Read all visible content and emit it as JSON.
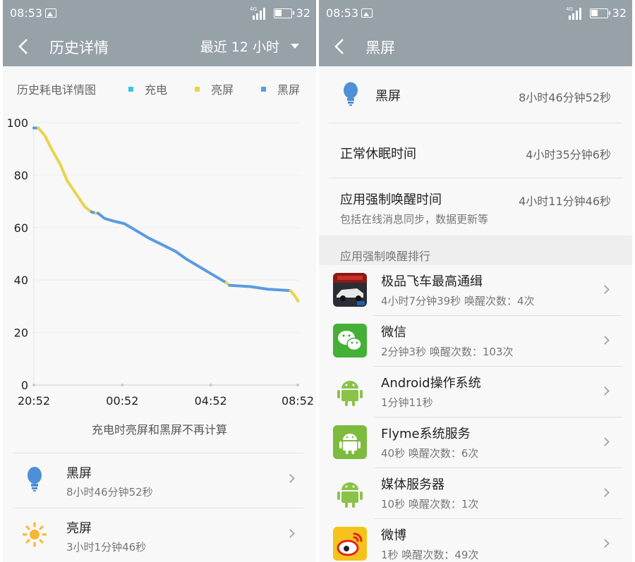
{
  "left": {
    "status_bar": {
      "time": "08:53",
      "network": "4G",
      "battery_level": "32"
    },
    "header": {
      "back_icon": "chevron-left-icon",
      "title": "历史详情",
      "filter": "最近 12 小时"
    },
    "chart_section": {
      "title": "历史耗电详情图",
      "legend": [
        {
          "label": "充电",
          "color": "#3cc3df"
        },
        {
          "label": "亮屏",
          "color": "#e8d44d"
        },
        {
          "label": "黑屏",
          "color": "#5b9be0"
        }
      ],
      "note": "充电时亮屏和黑屏不再计算"
    },
    "chart_data": {
      "type": "line",
      "ylim": [
        0,
        100
      ],
      "y_ticks": [
        "100",
        "80",
        "60",
        "40",
        "20",
        "0"
      ],
      "x_ticks": [
        "20:52",
        "00:52",
        "04:52",
        "08:52"
      ],
      "x_range_hours": [
        0,
        12
      ],
      "series": [
        {
          "name": "黑屏",
          "color": "#5b9be0",
          "points": [
            [
              0,
              98
            ],
            [
              0.2,
              98
            ]
          ]
        },
        {
          "name": "亮屏",
          "color": "#e8d44d",
          "points": [
            [
              0.2,
              98
            ],
            [
              0.5,
              95
            ],
            [
              0.8,
              90
            ],
            [
              1.2,
              84
            ],
            [
              1.5,
              78
            ],
            [
              1.9,
              73
            ],
            [
              2.3,
              68
            ],
            [
              2.6,
              66
            ]
          ]
        },
        {
          "name": "黑屏",
          "color": "#5b9be0",
          "points": [
            [
              2.6,
              66
            ],
            [
              2.8,
              65.5
            ]
          ]
        },
        {
          "name": "亮屏",
          "color": "#e8d44d",
          "points": [
            [
              2.8,
              65.5
            ],
            [
              2.9,
              65.5
            ]
          ]
        },
        {
          "name": "黑屏",
          "color": "#5b9be0",
          "points": [
            [
              2.9,
              65.5
            ],
            [
              3.2,
              63.5
            ],
            [
              3.6,
              62.5
            ],
            [
              4.1,
              61.5
            ],
            [
              4.6,
              59
            ],
            [
              5.2,
              56
            ],
            [
              5.8,
              53.5
            ],
            [
              6.4,
              51
            ],
            [
              6.9,
              48
            ],
            [
              7.4,
              45.5
            ],
            [
              7.9,
              43
            ],
            [
              8.4,
              40.5
            ],
            [
              8.7,
              39
            ]
          ]
        },
        {
          "name": "亮屏",
          "color": "#e8d44d",
          "points": [
            [
              8.7,
              39
            ],
            [
              8.85,
              38
            ]
          ]
        },
        {
          "name": "黑屏",
          "color": "#5b9be0",
          "points": [
            [
              8.85,
              38
            ],
            [
              9.8,
              37.5
            ],
            [
              10.6,
              36.5
            ],
            [
              11.6,
              36
            ]
          ]
        },
        {
          "name": "亮屏",
          "color": "#e8d44d",
          "points": [
            [
              11.6,
              36
            ],
            [
              11.8,
              34
            ],
            [
              11.95,
              32
            ]
          ]
        }
      ]
    },
    "usage_rows": [
      {
        "icon": "bulb-icon",
        "name": "黑屏",
        "value": "8小时46分钟52秒"
      },
      {
        "icon": "sun-icon",
        "name": "亮屏",
        "value": "3小时1分钟46秒"
      }
    ]
  },
  "right": {
    "status_bar": {
      "time": "08:53",
      "network": "4G",
      "battery_level": "32"
    },
    "header": {
      "back_icon": "chevron-left-icon",
      "title": "黑屏"
    },
    "summary": {
      "icon": "bulb-icon",
      "label": "黑屏",
      "value": "8小时46分钟52秒"
    },
    "normal_sleep": {
      "label": "正常休眠时间",
      "value": "4小时35分钟6秒"
    },
    "forced_wake": {
      "label": "应用强制唤醒时间",
      "value": "4小时11分钟46秒",
      "description": "包括在线消息同步，数据更新等"
    },
    "ranking_title": "应用强制唤醒排行",
    "apps": [
      {
        "icon": "racing-game-icon",
        "name": "极品飞车最高通缉",
        "detail": "4小时7分钟39秒  唤醒次数：4次"
      },
      {
        "icon": "wechat-icon",
        "name": "微信",
        "detail": "2分钟3秒  唤醒次数：103次"
      },
      {
        "icon": "android-icon",
        "name": "Android操作系统",
        "detail": "1分钟11秒"
      },
      {
        "icon": "android-square-icon",
        "name": "Flyme系统服务",
        "detail": "40秒  唤醒次数：6次"
      },
      {
        "icon": "android-icon",
        "name": "媒体服务器",
        "detail": "10秒  唤醒次数：1次"
      },
      {
        "icon": "weibo-icon",
        "name": "微博",
        "detail": "1秒  唤醒次数：49次"
      }
    ]
  }
}
